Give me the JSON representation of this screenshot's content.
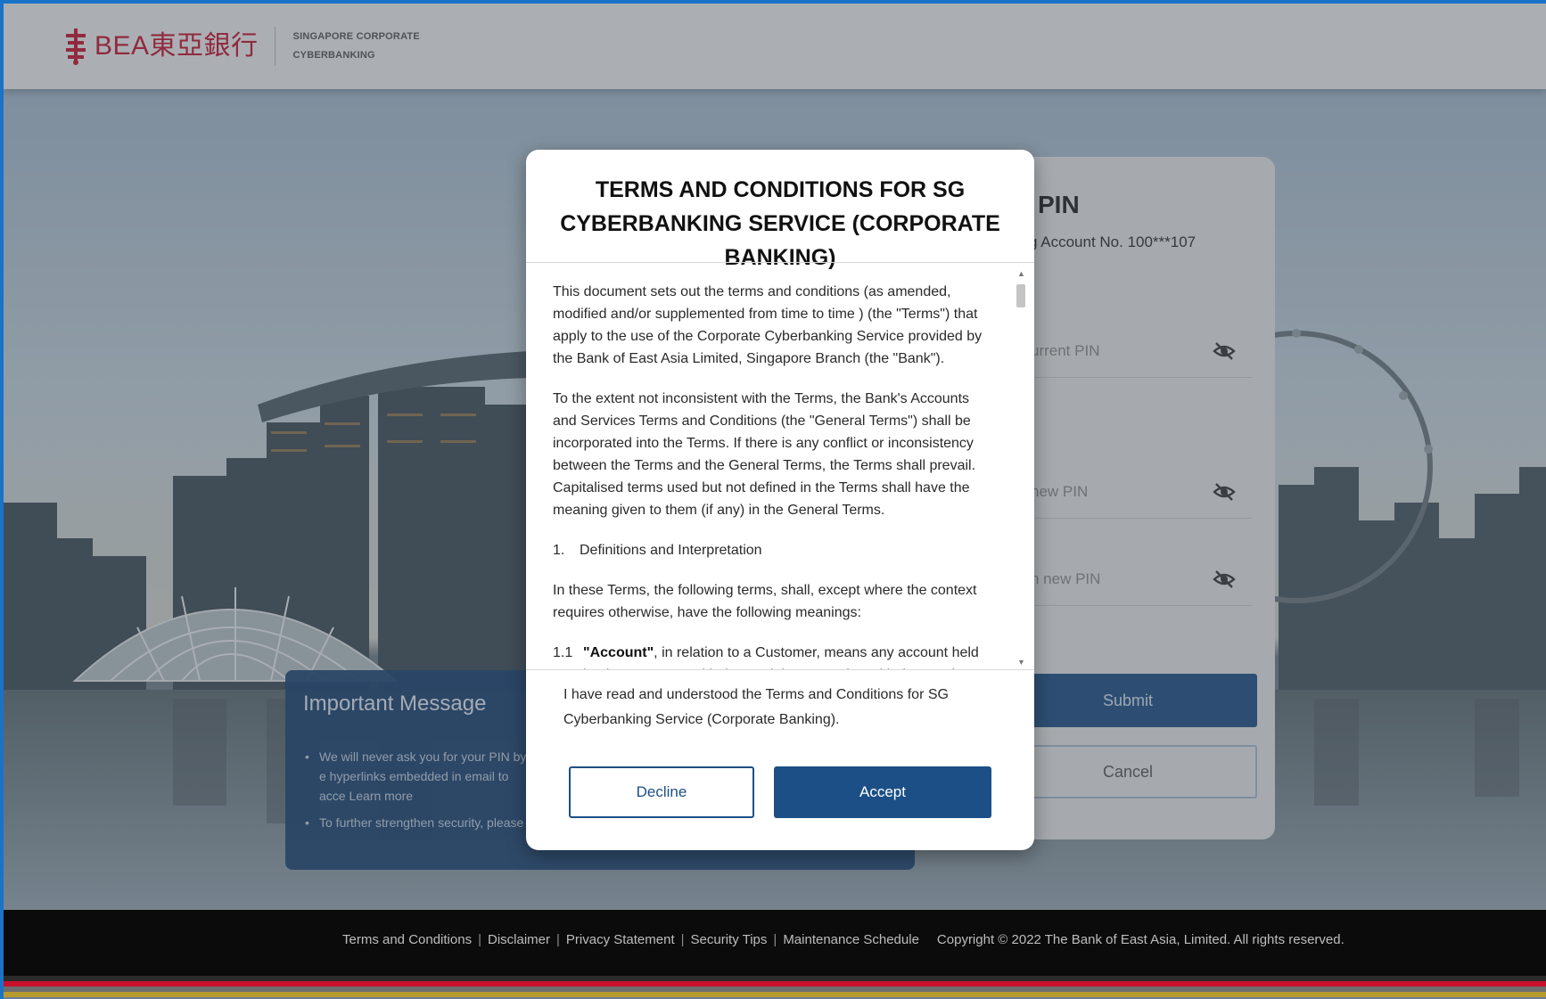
{
  "header": {
    "brand": "BEA東亞銀行",
    "sub_line1": "SINGAPORE CORPORATE",
    "sub_line2": "CYBERBANKING"
  },
  "pin_card": {
    "title": "PIN",
    "account": "g Account No. 100***107",
    "fields": [
      {
        "placeholder": "urrent PIN"
      },
      {
        "placeholder": "new PIN"
      },
      {
        "placeholder": "n new PIN"
      }
    ],
    "submit_label": "Submit",
    "cancel_label": "Cancel"
  },
  "important": {
    "title": "Important Message",
    "items": [
      "We will never ask you for your PIN by e hyperlinks embedded in email to acce Learn more",
      "To further strengthen security, please u"
    ]
  },
  "modal": {
    "title": "TERMS AND CONDITIONS FOR SG CYBERBANKING SERVICE (CORPORATE BANKING)",
    "para1": "This document sets out the terms and conditions (as amended, modified and/or supplemented from time to time ) (the \"Terms\") that apply to the use of the Corporate Cyberbanking Service provided by the Bank of East Asia Limited, Singapore Branch (the \"Bank\").",
    "para2": "To the extent not inconsistent with the Terms, the Bank's Accounts and Services Terms and Conditions (the \"General Terms\") shall be incorporated into the Terms. If there is any conflict or inconsistency between the Terms and the General Terms, the Terms shall prevail. Capitalised terms used but not defined in the Terms shall have the meaning given to them (if any) in the General Terms.",
    "section_num": "1.",
    "section_title": "Definitions and Interpretation",
    "para3": "In these Terms, the following terms, shall, except where the context requires otherwise, have the following meanings:",
    "def_num": "1.1",
    "def_term": "\"Account\"",
    "def_text": ", in relation to a Customer, means any account held by the Customer with the Bank in connection with the Service;",
    "agree_text": "I have read and understood the Terms and Conditions for SG Cyberbanking Service (Corporate Banking).",
    "decline_label": "Decline",
    "accept_label": "Accept"
  },
  "footer": {
    "links": [
      "Terms and Conditions",
      "Disclaimer",
      "Privacy Statement",
      "Security Tips",
      "Maintenance Schedule"
    ],
    "copyright": "Copyright © 2022 The Bank of East Asia, Limited. All rights reserved."
  },
  "colors": {
    "brand_red": "#c8102e",
    "primary_blue": "#1c4f86"
  }
}
